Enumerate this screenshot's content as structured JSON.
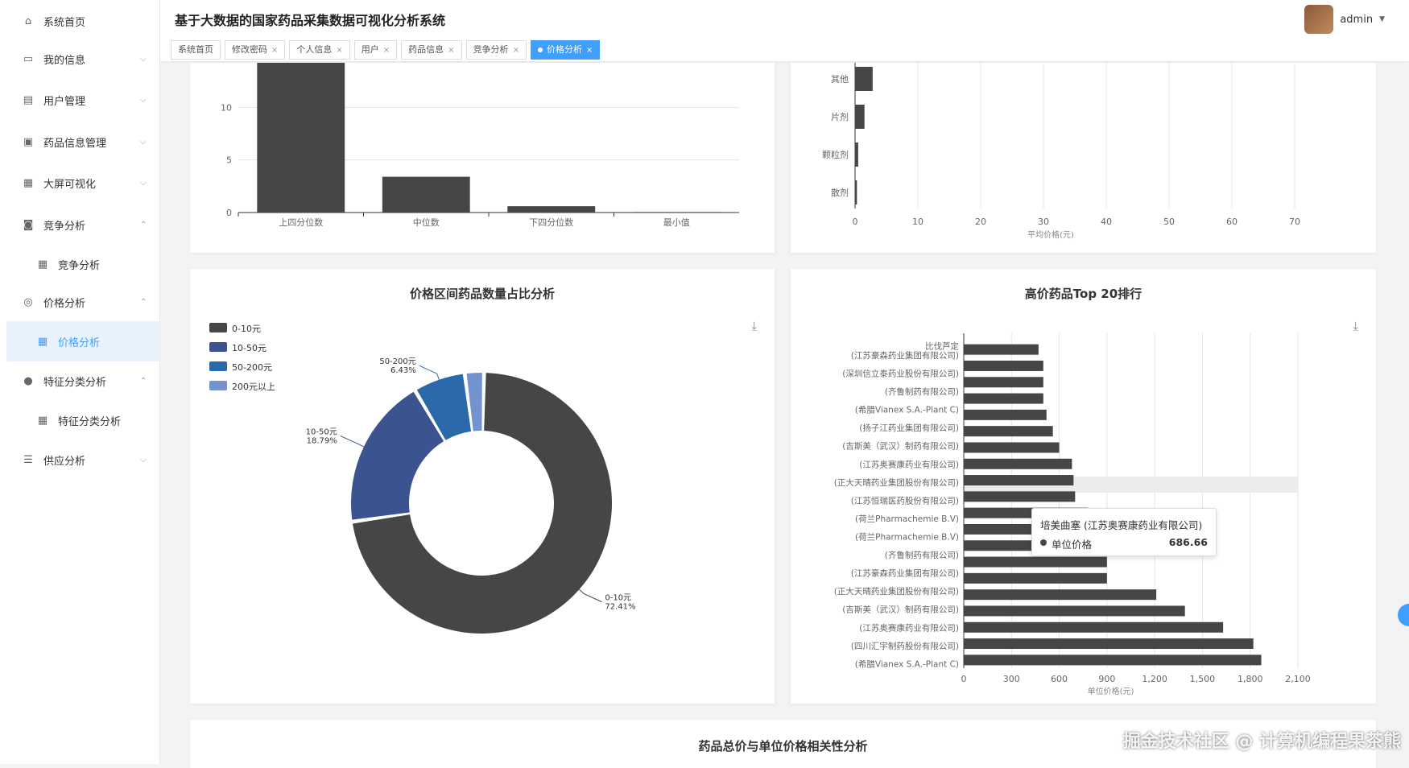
{
  "app_title": "基于大数据的国家药品采集数据可视化分析系统",
  "user": {
    "name": "admin"
  },
  "sidebar": [
    {
      "label": "系统首页",
      "icon": "home-icon",
      "arrow": ""
    },
    {
      "label": "我的信息",
      "icon": "id-card-icon",
      "arrow": "⌵"
    },
    {
      "label": "用户管理",
      "icon": "document-icon",
      "arrow": "⌵"
    },
    {
      "label": "药品信息管理",
      "icon": "clipboard-icon",
      "arrow": "⌵"
    },
    {
      "label": "大屏可视化",
      "icon": "grid-icon",
      "arrow": "⌵"
    },
    {
      "label": "竞争分析",
      "icon": "camera-icon",
      "arrow": "⌃"
    },
    {
      "label": "竞争分析",
      "icon": "grid-icon",
      "arrow": ""
    },
    {
      "label": "价格分析",
      "icon": "target-icon",
      "arrow": "⌃"
    },
    {
      "label": "价格分析",
      "icon": "grid-icon",
      "arrow": ""
    },
    {
      "label": "特征分类分析",
      "icon": "person-icon",
      "arrow": "⌃"
    },
    {
      "label": "特征分类分析",
      "icon": "grid-icon",
      "arrow": ""
    },
    {
      "label": "供应分析",
      "icon": "list-icon",
      "arrow": "⌵"
    }
  ],
  "tabs": [
    {
      "label": "系统首页",
      "closable": false
    },
    {
      "label": "修改密码",
      "closable": true
    },
    {
      "label": "个人信息",
      "closable": true
    },
    {
      "label": "用户",
      "closable": true
    },
    {
      "label": "药品信息",
      "closable": true
    },
    {
      "label": "竞争分析",
      "closable": true
    },
    {
      "label": "价格分析",
      "closable": true,
      "active": true
    }
  ],
  "cards": {
    "pie_title": "价格区间药品数量占比分析",
    "top20_title": "高价药品Top 20排行",
    "corr_title": "药品总价与单位价格相关性分析"
  },
  "tooltip": {
    "name": "培美曲塞 (江苏奥赛康药业有限公司)",
    "series": "单位价格",
    "value": "686.66"
  },
  "watermark": "掘金技术社区 @ 计算机编程果茶熊",
  "colors": {
    "accent": "#409eff",
    "bar": "#464646"
  },
  "chart_data": [
    {
      "type": "bar",
      "title": "",
      "categories": [
        "上四分位数",
        "中位数",
        "下四分位数",
        "最小值"
      ],
      "values": [
        15,
        3.4,
        0.6,
        0.05
      ],
      "ylim": [
        0,
        15
      ],
      "yticks": [
        0,
        5,
        10
      ]
    },
    {
      "type": "bar",
      "orientation": "horizontal",
      "categories": [
        "散剂",
        "颗粒剂",
        "片剂",
        "其他"
      ],
      "values": [
        0.3,
        0.5,
        1.5,
        2.8
      ],
      "xlim": [
        0,
        70
      ],
      "xticks": [
        0,
        10,
        20,
        30,
        40,
        50,
        60,
        70
      ],
      "xlabel": "平均价格(元)"
    },
    {
      "type": "pie",
      "title": "价格区间药品数量占比分析",
      "legend": [
        "0-10元",
        "10-50元",
        "50-200元",
        "200元以上"
      ],
      "values": [
        72.41,
        18.79,
        6.43,
        2.37
      ],
      "labels": [
        {
          "name": "0-10元",
          "pct": "72.41%"
        },
        {
          "name": "10-50元",
          "pct": "18.79%"
        },
        {
          "name": "50-200元",
          "pct": "6.43%"
        }
      ],
      "colors": [
        "#464646",
        "#3b5490",
        "#2a6aab",
        "#7393cf"
      ]
    },
    {
      "type": "bar",
      "orientation": "horizontal",
      "title": "高价药品Top 20排行",
      "xlabel": "单位价格(元)",
      "xlim": [
        0,
        2100
      ],
      "xticks": [
        "0",
        "300",
        "600",
        "900",
        "1,200",
        "1,500",
        "1,800",
        "2,100"
      ],
      "categories": [
        "(希腊Vianex S.A.-Plant C)",
        "",
        "(四川汇宇制药股份有限公司)",
        "",
        "(江苏奥赛康药业有限公司)",
        "",
        "(吉斯美（武汉）制药有限公司)",
        "",
        "(正大天晴药业集团股份有限公司)",
        "",
        "(江苏豪森药业集团有限公司)",
        "",
        "(齐鲁制药有限公司)",
        "",
        "(荷兰Pharmachemie B.V)",
        "",
        "(荷兰Pharmachemie B.V)",
        "",
        "(江苏恒瑞医药股份有限公司)",
        "",
        "(正大天晴药业集团股份有限公司)",
        "",
        "(江苏奥赛康药业有限公司)",
        "",
        "(吉斯美（武汉）制药有限公司)",
        "",
        "(扬子江药业集团有限公司)",
        "",
        "(希腊Vianex S.A.-Plant C)",
        "",
        "(齐鲁制药有限公司)",
        "",
        "(深圳信立泰药业股份有限公司)",
        "",
        "(江苏豪森药业集团有限公司)",
        "比伐芦定"
      ],
      "values": [
        1870,
        1820,
        1630,
        1390,
        1210,
        900,
        900,
        790,
        790,
        780,
        700,
        690,
        680,
        600,
        560,
        520,
        500,
        500,
        500,
        470
      ]
    }
  ]
}
